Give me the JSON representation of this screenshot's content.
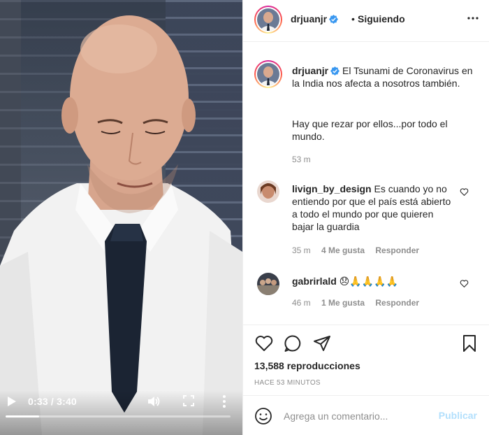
{
  "video": {
    "time": "0:33 / 3:40",
    "progress": 0.15,
    "icons": [
      "play-icon",
      "volume-icon",
      "fullscreen-icon",
      "more-vertical-icon"
    ]
  },
  "header": {
    "username": "drjuanjr",
    "separator": "•",
    "follow_label": "Siguiendo"
  },
  "caption": {
    "username": "drjuanjr",
    "text_1": " El Tsunami de Coronavirus en la India nos afecta a nosotros también.",
    "text_2": "Hay que rezar por ellos...por todo el mundo.",
    "time": "53 m"
  },
  "comments": [
    {
      "username": "livign_by_design",
      "text": " Es cuando yo no entiendo por que el país está abierto a todo el mundo por que quieren bajar la guardia",
      "time": "35 m",
      "likes": "4 Me gusta",
      "reply": "Responder"
    },
    {
      "username": "gabrirlald",
      "text": " 😞🙏🙏🙏🙏",
      "time": "46 m",
      "likes": "1 Me gusta",
      "reply": "Responder"
    }
  ],
  "actions": {
    "views": "13,588 reproducciones",
    "ago": "HACE 53 MINUTOS",
    "icons": [
      "heart-icon",
      "comment-icon",
      "share-icon",
      "bookmark-icon"
    ]
  },
  "compose": {
    "placeholder": "Agrega un comentario...",
    "post_label": "Publicar"
  },
  "colors": {
    "accent": "#0095f6",
    "post_disabled": "#b2dffc",
    "verified": "#3897f0",
    "muted": "#8e8e8e"
  }
}
